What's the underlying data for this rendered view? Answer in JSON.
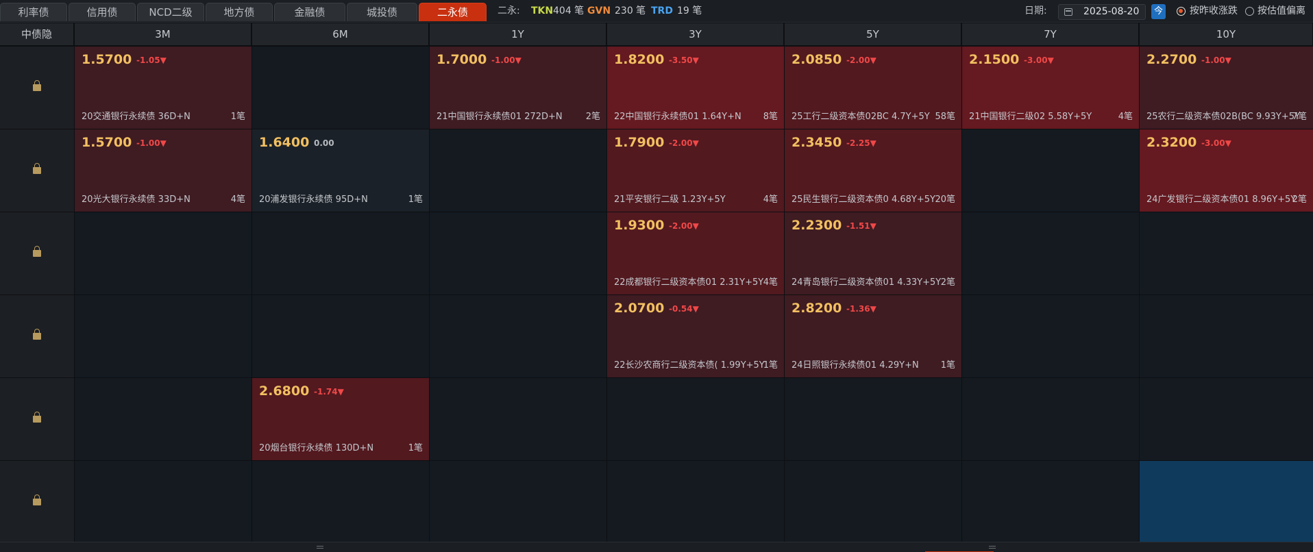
{
  "tabs": [
    "利率债",
    "信用债",
    "NCD二级",
    "地方债",
    "金融债",
    "城投债",
    "二永债"
  ],
  "active_tab": 6,
  "stats": {
    "label": "二永:",
    "items": [
      {
        "tag": "TKN",
        "value": "404 笔",
        "color": "#c6d94a"
      },
      {
        "tag": "GVN",
        "value": "230 笔",
        "color": "#f08a3a"
      },
      {
        "tag": "TRD",
        "value": "19 笔",
        "color": "#4aa3f0"
      }
    ]
  },
  "date": {
    "label": "日期:",
    "value": "2025-08-20",
    "today_label": "今"
  },
  "radios": [
    {
      "label": "按昨收涨跌",
      "checked": true
    },
    {
      "label": "按估值偏离",
      "checked": false
    }
  ],
  "header": {
    "row_label": "中债隐",
    "columns": [
      "3M",
      "6M",
      "1Y",
      "3Y",
      "5Y",
      "7Y",
      "10Y"
    ]
  },
  "rows": [
    [
      {
        "yield": "1.5700",
        "change": "-1.05▼",
        "bond": "20交通银行永续债 36D+N",
        "count": "1笔",
        "tone": "t1"
      },
      null,
      {
        "yield": "1.7000",
        "change": "-1.00▼",
        "bond": "21中国银行永续债01 272D+N",
        "count": "2笔",
        "tone": "t1"
      },
      {
        "yield": "1.8200",
        "change": "-3.50▼",
        "bond": "22中国银行永续债01 1.64Y+N",
        "count": "8笔",
        "tone": "t3"
      },
      {
        "yield": "2.0850",
        "change": "-2.00▼",
        "bond": "25工行二级资本债02BC 4.7Y+5Y",
        "count": "58笔",
        "tone": "t2"
      },
      {
        "yield": "2.1500",
        "change": "-3.00▼",
        "bond": "21中国银行二级02 5.58Y+5Y",
        "count": "4笔",
        "tone": "t3"
      },
      {
        "yield": "2.2700",
        "change": "-1.00▼",
        "bond": "25农行二级资本债02B(BC 9.93Y+5Y",
        "count": "7笔",
        "tone": "t1"
      }
    ],
    [
      {
        "yield": "1.5700",
        "change": "-1.00▼",
        "bond": "20光大银行永续债 33D+N",
        "count": "4笔",
        "tone": "t1"
      },
      {
        "yield": "1.6400",
        "change": "0.00",
        "bond": "20浦发银行永续债 95D+N",
        "count": "1笔",
        "tone": "neutral"
      },
      null,
      {
        "yield": "1.7900",
        "change": "-2.00▼",
        "bond": "21平安银行二级 1.23Y+5Y",
        "count": "4笔",
        "tone": "t2"
      },
      {
        "yield": "2.3450",
        "change": "-2.25▼",
        "bond": "25民生银行二级资本债0 4.68Y+5Y",
        "count": "20笔",
        "tone": "t2"
      },
      null,
      {
        "yield": "2.3200",
        "change": "-3.00▼",
        "bond": "24广发银行二级资本债01 8.96Y+5Y",
        "count": "2笔",
        "tone": "t3"
      }
    ],
    [
      null,
      null,
      null,
      {
        "yield": "1.9300",
        "change": "-2.00▼",
        "bond": "22成都银行二级资本债01 2.31Y+5Y",
        "count": "4笔",
        "tone": "t2"
      },
      {
        "yield": "2.2300",
        "change": "-1.51▼",
        "bond": "24青岛银行二级资本债01 4.33Y+5Y",
        "count": "2笔",
        "tone": "t1"
      },
      null,
      null
    ],
    [
      null,
      null,
      null,
      {
        "yield": "2.0700",
        "change": "-0.54▼",
        "bond": "22长沙农商行二级资本债( 1.99Y+5Y",
        "count": "1笔",
        "tone": "t1"
      },
      {
        "yield": "2.8200",
        "change": "-1.36▼",
        "bond": "24日照银行永续债01 4.29Y+N",
        "count": "1笔",
        "tone": "t1"
      },
      null,
      null
    ],
    [
      null,
      {
        "yield": "2.6800",
        "change": "-1.74▼",
        "bond": "20烟台银行永续债 130D+N",
        "count": "1笔",
        "tone": "t2"
      },
      null,
      null,
      null,
      null,
      null
    ],
    [
      null,
      null,
      null,
      null,
      null,
      null,
      {
        "selected": true
      }
    ]
  ]
}
